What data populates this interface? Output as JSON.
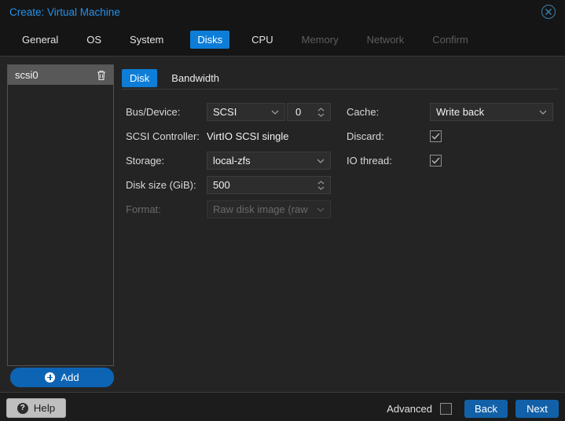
{
  "window": {
    "title": "Create: Virtual Machine"
  },
  "colors": {
    "accent_tab_active": "#0d7dd8",
    "accent_button": "#1261a8",
    "accent_title": "#2492ec",
    "background": "#242424",
    "header_background": "#151515",
    "field_background": "#2d2d2d",
    "selected_item_background": "#585858"
  },
  "header": {
    "tabs": [
      {
        "label": "General",
        "state": "enabled"
      },
      {
        "label": "OS",
        "state": "enabled"
      },
      {
        "label": "System",
        "state": "enabled"
      },
      {
        "label": "Disks",
        "state": "active"
      },
      {
        "label": "CPU",
        "state": "enabled"
      },
      {
        "label": "Memory",
        "state": "disabled"
      },
      {
        "label": "Network",
        "state": "disabled"
      },
      {
        "label": "Confirm",
        "state": "disabled"
      }
    ]
  },
  "sidebar": {
    "items": [
      {
        "label": "scsi0",
        "selected": true
      }
    ],
    "add_label": "Add"
  },
  "panel": {
    "tabs": {
      "disk": "Disk",
      "bandwidth": "Bandwidth"
    },
    "left": {
      "bus_device": {
        "label": "Bus/Device:",
        "bus_value": "SCSI",
        "index_value": "0"
      },
      "scsi_controller": {
        "label": "SCSI Controller:",
        "value": "VirtIO SCSI single"
      },
      "storage": {
        "label": "Storage:",
        "value": "local-zfs"
      },
      "disk_size": {
        "label": "Disk size (GiB):",
        "value": "500"
      },
      "format": {
        "label": "Format:",
        "value": "Raw disk image (raw",
        "disabled": true
      }
    },
    "right": {
      "cache": {
        "label": "Cache:",
        "value": "Write back"
      },
      "discard": {
        "label": "Discard:",
        "checked": true
      },
      "io_thread": {
        "label": "IO thread:",
        "checked": true
      }
    }
  },
  "footer": {
    "help_label": "Help",
    "advanced_label": "Advanced",
    "advanced_checked": false,
    "back_label": "Back",
    "next_label": "Next"
  }
}
